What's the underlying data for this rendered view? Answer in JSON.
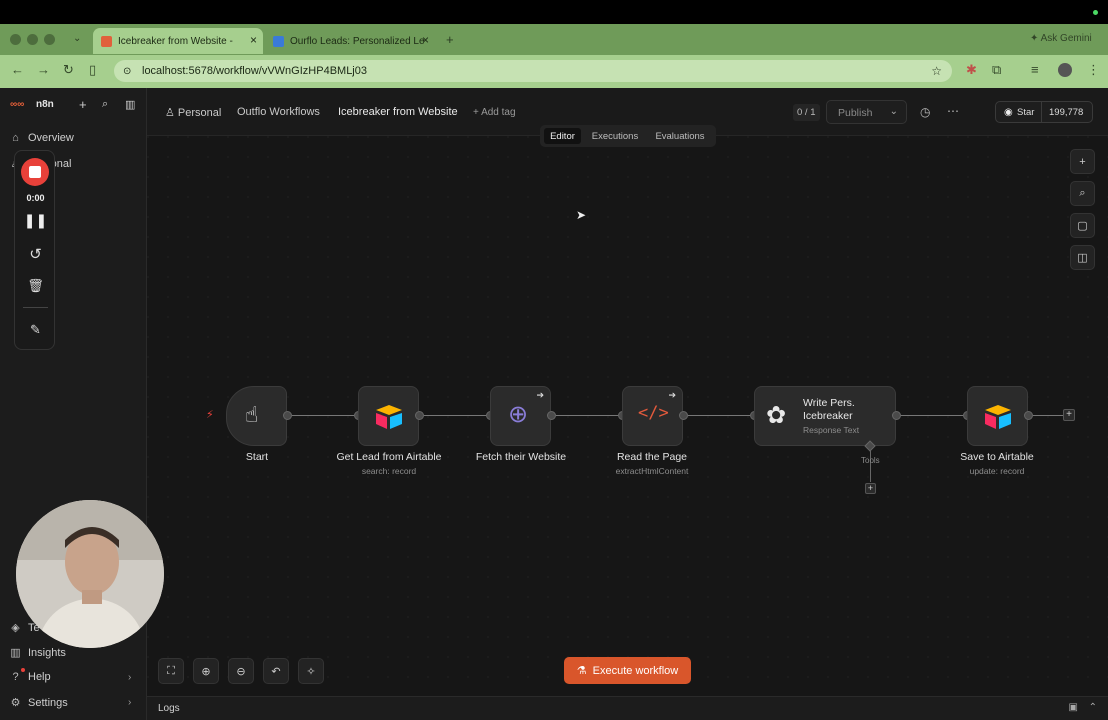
{
  "browser": {
    "tabs": [
      {
        "title": "Icebreaker from Website -",
        "active": true
      },
      {
        "title": "Ourflo Leads: Personalized Le",
        "active": false
      }
    ],
    "url": "localhost:5678/workflow/vVWnGIzHP4BMLj03",
    "ask_gemini": "Ask Gemini"
  },
  "sidebar": {
    "brand": "n8n",
    "overview": "Overview",
    "personal": "Personal",
    "templates": "Te",
    "insights": "Insights",
    "help": "Help",
    "settings": "Settings"
  },
  "recorder": {
    "time": "0:00"
  },
  "header": {
    "breadcrumb_personal": "Personal",
    "breadcrumb_folder": "Outflo Workflows",
    "workflow_name": "Icebreaker from Website",
    "add_tag": "+ Add tag",
    "counter": "0 / 1",
    "publish": "Publish",
    "github_star": "Star",
    "github_count": "199,778",
    "tabs": [
      "Editor",
      "Executions",
      "Evaluations"
    ],
    "active_tab": "Editor"
  },
  "nodes": [
    {
      "label": "Start",
      "sub": ""
    },
    {
      "label": "Get Lead from Airtable",
      "sub": "search: record"
    },
    {
      "label": "Fetch their Website",
      "sub": ""
    },
    {
      "label": "Read the Page",
      "sub": "extractHtmlContent"
    },
    {
      "label": "Write Pers. Icebreaker",
      "sub": "Response Text"
    },
    {
      "label": "Save to Airtable",
      "sub": "update: record"
    }
  ],
  "tools_label": "Tools",
  "execute_button": "Execute workflow",
  "logs_label": "Logs",
  "colors": {
    "accent": "#d9562b",
    "record": "#e8413a",
    "tab_green": "#6f9b59"
  }
}
